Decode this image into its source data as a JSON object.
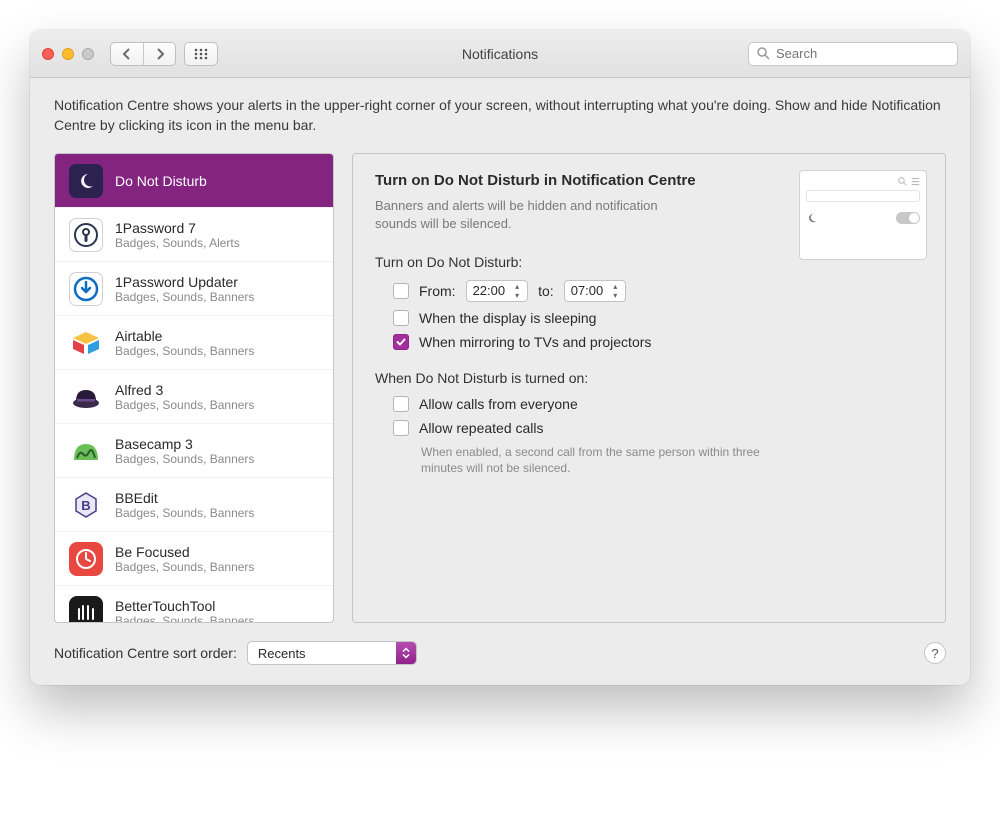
{
  "window": {
    "title": "Notifications",
    "search_placeholder": "Search"
  },
  "intro": "Notification Centre shows your alerts in the upper-right corner of your screen, without interrupting what you're doing. Show and hide Notification Centre by clicking its icon in the menu bar.",
  "sidebar": {
    "items": [
      {
        "name": "Do Not Disturb",
        "subtitle": ""
      },
      {
        "name": "1Password 7",
        "subtitle": "Badges, Sounds, Alerts"
      },
      {
        "name": "1Password Updater",
        "subtitle": "Badges, Sounds, Banners"
      },
      {
        "name": "Airtable",
        "subtitle": "Badges, Sounds, Banners"
      },
      {
        "name": "Alfred 3",
        "subtitle": "Badges, Sounds, Banners"
      },
      {
        "name": "Basecamp 3",
        "subtitle": "Badges, Sounds, Banners"
      },
      {
        "name": "BBEdit",
        "subtitle": "Badges, Sounds, Banners"
      },
      {
        "name": "Be Focused",
        "subtitle": "Badges, Sounds, Banners"
      },
      {
        "name": "BetterTouchTool",
        "subtitle": "Badges, Sounds, Banners"
      }
    ]
  },
  "detail": {
    "heading": "Turn on Do Not Disturb in Notification Centre",
    "hint": "Banners and alerts will be hidden and notification sounds will be silenced.",
    "turn_on_label": "Turn on Do Not Disturb:",
    "from_label": "From:",
    "from_time": "22:00",
    "to_label": "to:",
    "to_time": "07:00",
    "sleeping_label": "When the display is sleeping",
    "mirroring_label": "When mirroring to TVs and projectors",
    "when_on_label": "When Do Not Disturb is turned on:",
    "allow_everyone_label": "Allow calls from everyone",
    "allow_repeated_label": "Allow repeated calls",
    "repeated_hint": "When enabled, a second call from the same person within three minutes will not be silenced."
  },
  "footer": {
    "sort_label": "Notification Centre sort order:",
    "sort_value": "Recents",
    "help": "?"
  },
  "colors": {
    "accent": "#a32f9e",
    "selection": "#832481"
  }
}
